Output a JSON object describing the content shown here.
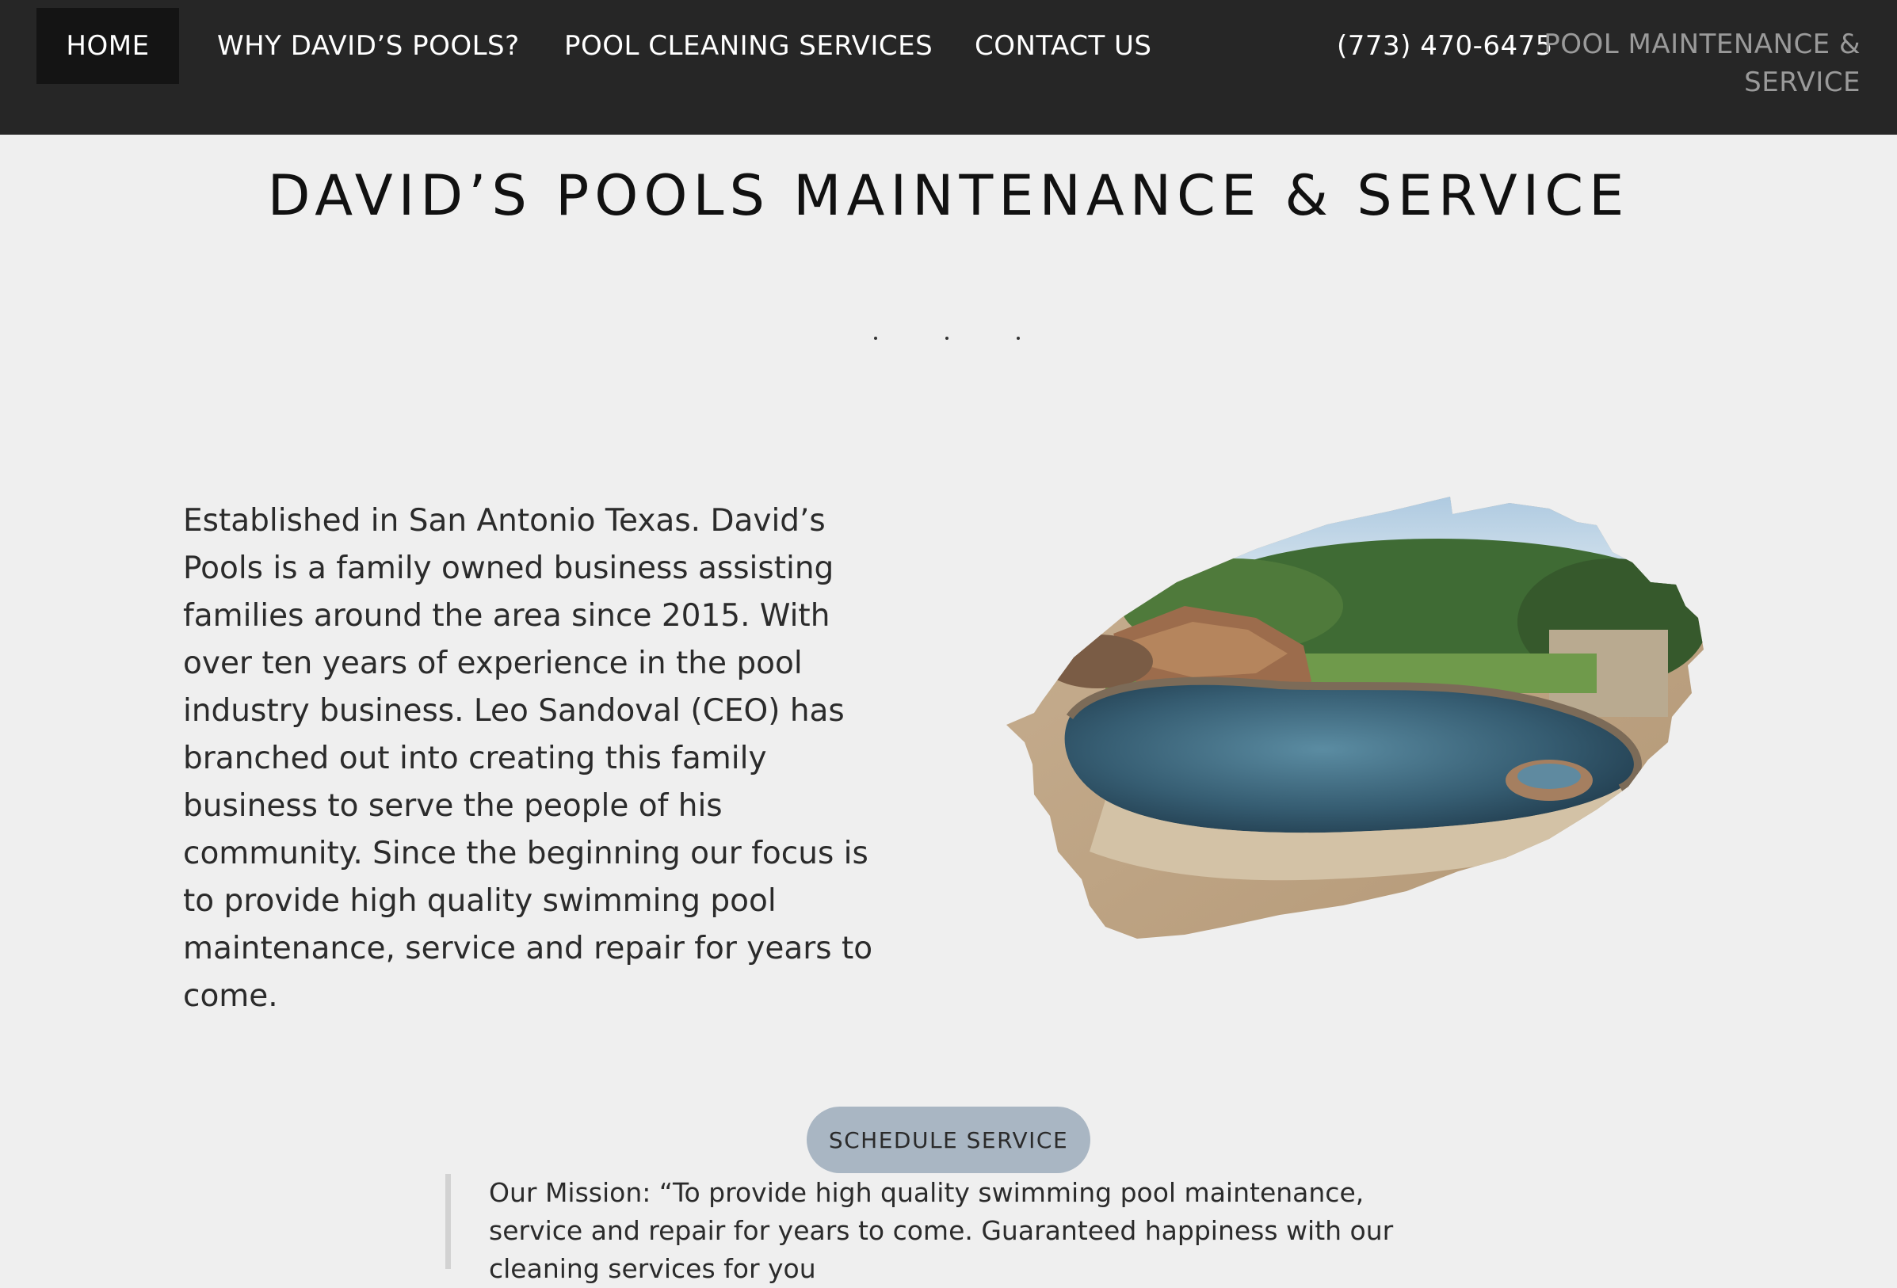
{
  "nav": {
    "items": [
      {
        "label": "HOME"
      },
      {
        "label": "WHY DAVID’S POOLS?"
      },
      {
        "label": "POOL CLEANING SERVICES"
      },
      {
        "label": "CONTACT US"
      }
    ],
    "phone": "(773) 470-6475",
    "brand": "POOL MAINTENANCE & SERVICE"
  },
  "hero": {
    "title": "DAVID’S POOLS MAINTENANCE & SERVICE",
    "intro": "Established in San Antonio Texas. David’s Pools is a family owned business assisting families around the area since 2015. With over ten years of experience in the pool industry business. Leo Sandoval (CEO) has branched out into creating this family business to serve the people of his community. Since the beginning our focus is to provide high quality swimming pool maintenance, service and repair for years to come."
  },
  "cta": {
    "label": "SCHEDULE SERVICE"
  },
  "mission": {
    "text": "Our Mission: “To provide high quality swimming pool maintenance, service and repair for years to come. Guaranteed happiness with our cleaning services for you"
  },
  "colors": {
    "topbar": "#262626",
    "active_nav": "#141414",
    "page_background": "#efefef",
    "button": "#a9b6c3",
    "brand_text": "#9a9a9a"
  },
  "icons": [
    "pool-photo-brush-shape"
  ]
}
